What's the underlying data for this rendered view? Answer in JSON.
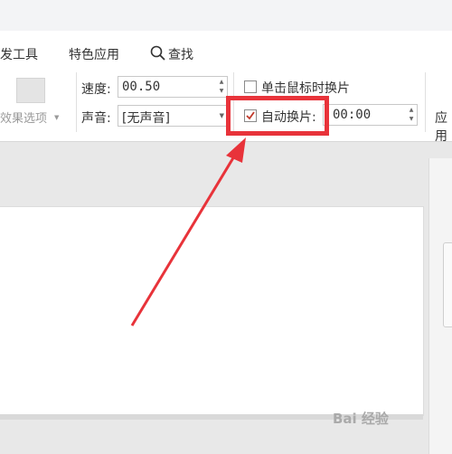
{
  "menu": {
    "dev_tools": "发工具",
    "special_apps": "特色应用",
    "search": "查找"
  },
  "ribbon": {
    "effect_options": "效果选项",
    "speed_label": "速度:",
    "speed_value": "00.50",
    "sound_label": "声音:",
    "sound_value": "[无声音]",
    "on_click_label": "单击鼠标时换片",
    "auto_advance_label": "自动换片:",
    "auto_advance_time": "00:00",
    "auto_advance_checked": true,
    "apply_partial": "应用"
  },
  "watermark": "Bai 经验",
  "colors": {
    "highlight": "#e8333a",
    "arrow": "#e8333a"
  }
}
